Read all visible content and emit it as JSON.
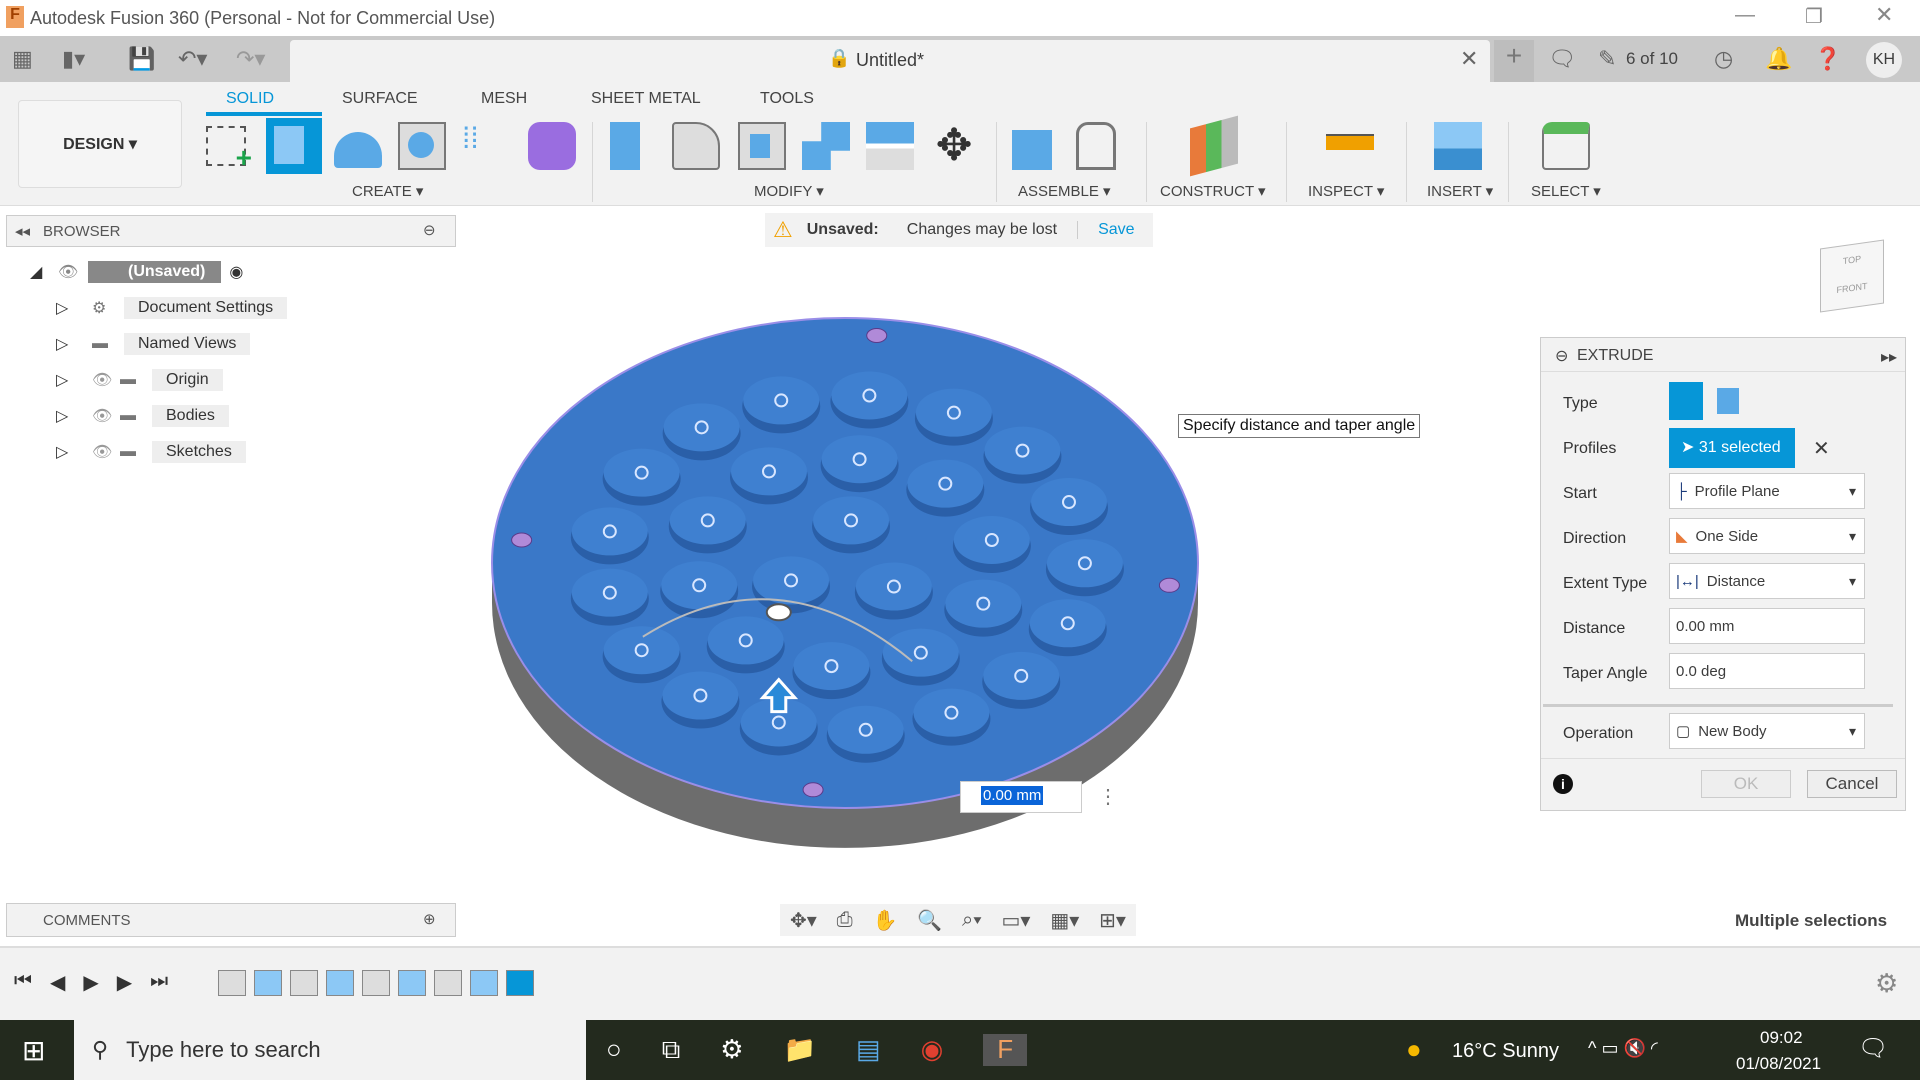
{
  "app": {
    "title": "Autodesk Fusion 360 (Personal - Not for Commercial Use)",
    "document": "Untitled*",
    "jobs": "6 of 10",
    "user_initials": "KH"
  },
  "ribbon": {
    "workspace": "DESIGN ▾",
    "tabs": [
      "SOLID",
      "SURFACE",
      "MESH",
      "SHEET METAL",
      "TOOLS"
    ],
    "active_tab": "SOLID",
    "groups": [
      "CREATE ▾",
      "MODIFY ▾",
      "ASSEMBLE ▾",
      "CONSTRUCT ▾",
      "INSPECT ▾",
      "INSERT ▾",
      "SELECT ▾"
    ],
    "accent": "#0696d7"
  },
  "browser": {
    "title": "BROWSER",
    "root": "(Unsaved)",
    "items": [
      "Document Settings",
      "Named Views",
      "Origin",
      "Bodies",
      "Sketches"
    ]
  },
  "unsaved": {
    "label": "Unsaved:",
    "message": "Changes may be lost",
    "save": "Save"
  },
  "viewcube": {
    "top": "TOP",
    "front": "FRONT"
  },
  "tooltip": "Specify distance and taper angle",
  "distance_input": "0.00 mm",
  "extrude": {
    "title": "EXTRUDE",
    "labels": {
      "type": "Type",
      "profiles": "Profiles",
      "start": "Start",
      "direction": "Direction",
      "extent": "Extent Type",
      "distance": "Distance",
      "taper": "Taper Angle",
      "operation": "Operation"
    },
    "profiles": "31 selected",
    "start": "Profile Plane",
    "direction": "One Side",
    "extent": "Distance",
    "distance": "0.00 mm",
    "taper": "0.0 deg",
    "operation": "New Body",
    "ok": "OK",
    "cancel": "Cancel"
  },
  "comments": "COMMENTS",
  "status": "Multiple selections",
  "taskbar": {
    "search": "Type here to search",
    "weather": "16°C  Sunny",
    "time": "09:02",
    "date": "01/08/2021"
  },
  "colors": {
    "body_top": "#3a78c8",
    "body_side": "#6d6d6d",
    "taskbar": "#232a1e"
  }
}
